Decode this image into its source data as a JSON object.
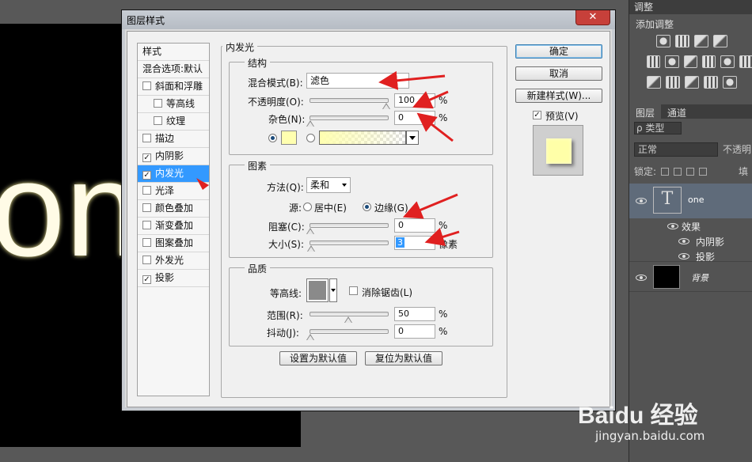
{
  "canvas": {
    "text": "on"
  },
  "dialog": {
    "title": "图层样式",
    "close_glyph": "✕",
    "style_list": {
      "header": "样式",
      "blending": "混合选项:默认",
      "items": [
        {
          "label": "斜面和浮雕",
          "checked": false,
          "indent": false
        },
        {
          "label": "等高线",
          "checked": false,
          "indent": true
        },
        {
          "label": "纹理",
          "checked": false,
          "indent": true
        },
        {
          "label": "描边",
          "checked": false,
          "indent": false
        },
        {
          "label": "内阴影",
          "checked": true,
          "indent": false
        },
        {
          "label": "内发光",
          "checked": true,
          "indent": false,
          "selected": true
        },
        {
          "label": "光泽",
          "checked": false,
          "indent": false
        },
        {
          "label": "颜色叠加",
          "checked": false,
          "indent": false
        },
        {
          "label": "渐变叠加",
          "checked": false,
          "indent": false
        },
        {
          "label": "图案叠加",
          "checked": false,
          "indent": false
        },
        {
          "label": "外发光",
          "checked": false,
          "indent": false
        },
        {
          "label": "投影",
          "checked": true,
          "indent": false
        }
      ]
    },
    "section_title": "内发光",
    "structure": {
      "title": "结构",
      "blend_mode_label": "混合模式(B):",
      "blend_mode_value": "滤色",
      "opacity_label": "不透明度(O):",
      "opacity_value": "100",
      "noise_label": "杂色(N):",
      "noise_value": "0",
      "percent": "%",
      "glow_color": "#ffffb0"
    },
    "elements": {
      "title": "图素",
      "method_label": "方法(Q):",
      "method_value": "柔和",
      "source_label": "源:",
      "source_center": "居中(E)",
      "source_edge": "边缘(G)",
      "choke_label": "阻塞(C):",
      "choke_value": "0",
      "size_label": "大小(S):",
      "size_value": "3",
      "size_unit": "像素",
      "percent": "%"
    },
    "quality": {
      "title": "品质",
      "contour_label": "等高线:",
      "antialias_label": "消除锯齿(L)",
      "range_label": "范围(R):",
      "range_value": "50",
      "jitter_label": "抖动(J):",
      "jitter_value": "0",
      "percent": "%"
    },
    "buttons": {
      "make_default": "设置为默认值",
      "reset_default": "复位为默认值",
      "ok": "确定",
      "cancel": "取消",
      "new_style": "新建样式(W)...",
      "preview": "预览(V)"
    },
    "slider_levels": {
      "opacity": 100,
      "noise": 0,
      "choke": 0,
      "size": 3,
      "range": 50,
      "jitter": 0
    }
  },
  "right_panel": {
    "adjust_tab": "调整",
    "adjust_title": "添加调整",
    "layers_tab": "图层",
    "channels_tab": "通道",
    "filter_label": "ρ 类型",
    "blend_mode": "正常",
    "opacity_label": "不透明",
    "lock_label": "锁定:",
    "fill_label": "填",
    "layers": [
      {
        "name": "one",
        "type": "text"
      },
      {
        "name": "背景",
        "type": "background"
      }
    ],
    "effects_label": "效果",
    "effects": [
      "内阴影",
      "投影"
    ]
  }
}
